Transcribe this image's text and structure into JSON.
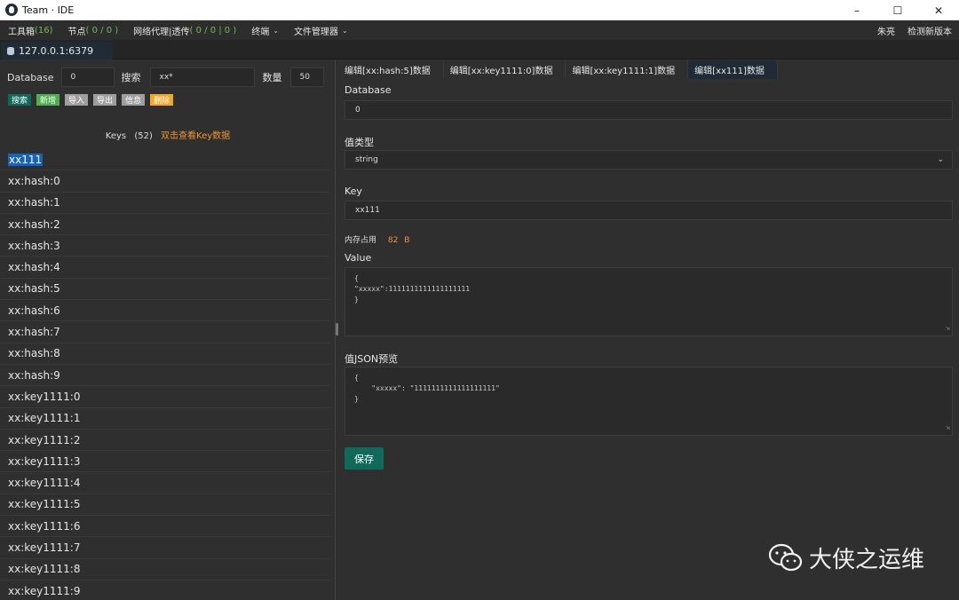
{
  "window": {
    "title": "Team · IDE",
    "controls": [
      "–",
      "☐",
      "✕"
    ]
  },
  "menu": {
    "toolbox": "工具箱",
    "toolbox_count": "(16)",
    "node": "节点",
    "node_count": "( 0 / 0 )",
    "proxy": "网络代理|透传",
    "proxy_count": "( 0 / 0 | 0 )",
    "terminal": "终端",
    "file_manager": "文件管理器",
    "user": "朱亮",
    "check_update": "检测新版本"
  },
  "connection": {
    "tab_label": "127.0.0.1:6379"
  },
  "filter": {
    "database_label": "Database",
    "database_value": "0",
    "search_label": "搜索",
    "search_value": "xx*",
    "count_label": "数量",
    "count_value": "50"
  },
  "actions": {
    "search": "搜索",
    "add": "新增",
    "import": "导入",
    "export": "导出",
    "info": "信息",
    "delete": "删除"
  },
  "colors": {
    "search_btn": "#0e6b5b",
    "add_btn": "#4caf50",
    "import_btn": "#9e9e9e",
    "export_btn": "#9e9e9e",
    "info_btn": "#9e9e9e",
    "delete_btn": "#f5a623",
    "selection": "#1565c0",
    "accent_orange": "#f0962d"
  },
  "keys": {
    "header": "Keys",
    "count": "(52)",
    "hint": "双击查看Key数据",
    "items": [
      "xx111",
      "xx:hash:0",
      "xx:hash:1",
      "xx:hash:2",
      "xx:hash:3",
      "xx:hash:4",
      "xx:hash:5",
      "xx:hash:6",
      "xx:hash:7",
      "xx:hash:8",
      "xx:hash:9",
      "xx:key1111:0",
      "xx:key1111:1",
      "xx:key1111:2",
      "xx:key1111:3",
      "xx:key1111:4",
      "xx:key1111:5",
      "xx:key1111:6",
      "xx:key1111:7",
      "xx:key1111:8",
      "xx:key1111:9"
    ],
    "selected": "xx111"
  },
  "editor": {
    "tabs": [
      "编辑[xx:hash:5]数据",
      "编辑[xx:key1111:0]数据",
      "编辑[xx:key1111:1]数据",
      "编辑[xx111]数据"
    ],
    "active_tab": 3,
    "database_label": "Database",
    "database_value": "0",
    "type_label": "值类型",
    "type_value": "string",
    "key_label": "Key",
    "key_value": "xx111",
    "memory_label": "内存占用",
    "memory_value": "82",
    "memory_unit": "B",
    "value_label": "Value",
    "value_text": "{\n\"xxxxx\":1111111111111111111\n}",
    "preview_label": "值JSON预览",
    "preview_text": "{\n    \"xxxxx\": \"1111111111111111111\"\n}",
    "save": "保存"
  },
  "watermark": "大侠之运维"
}
